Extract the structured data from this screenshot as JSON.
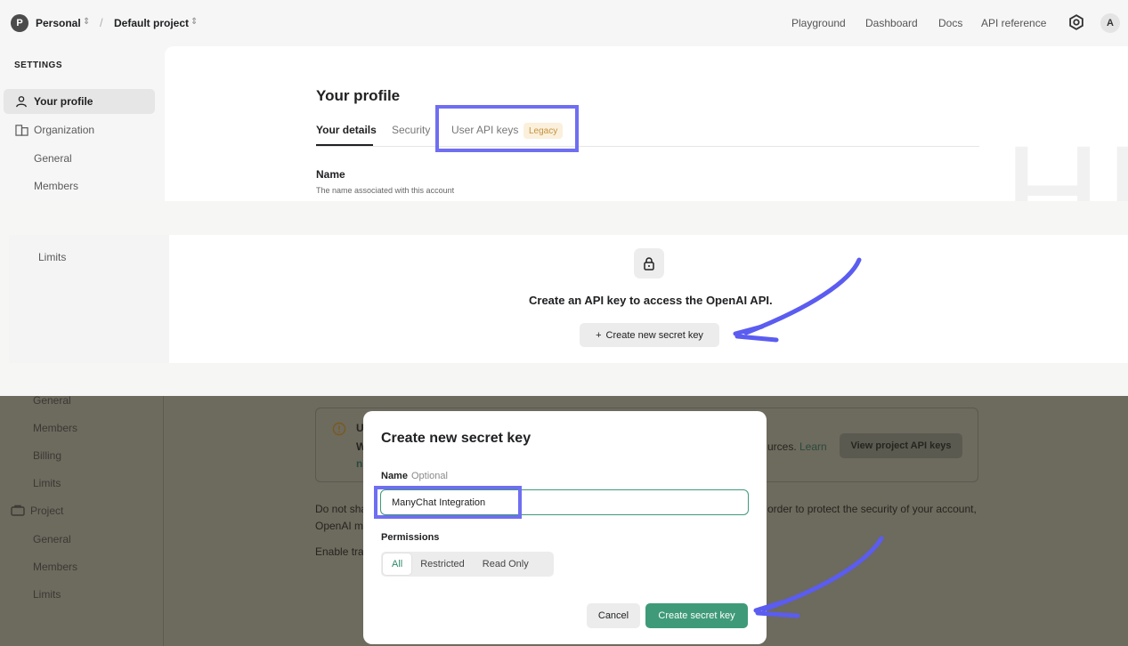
{
  "topbar": {
    "org_initial": "P",
    "org_name": "Personal",
    "project_name": "Default project",
    "separator": "/",
    "nav": [
      "Playground",
      "Dashboard",
      "Docs",
      "API reference"
    ],
    "user_initial": "A"
  },
  "sidebar": {
    "heading": "SETTINGS",
    "your_profile": "Your profile",
    "organization": "Organization",
    "org_general": "General",
    "org_members": "Members"
  },
  "profile": {
    "title": "Your profile",
    "tabs": [
      "Your details",
      "Security",
      "User API keys"
    ],
    "legacy_badge": "Legacy",
    "name_label": "Name",
    "name_sub": "The name associated with this account",
    "bg_letters": "HE"
  },
  "empty_state": {
    "limits": "Limits",
    "message": "Create an API key to access the OpenAI API.",
    "button": "Create new secret key",
    "button_plus": "+"
  },
  "panel3": {
    "sidebar": [
      "General",
      "Members",
      "Billing",
      "Limits",
      "Project",
      "General",
      "Members",
      "Limits"
    ],
    "bg_u": "U",
    "bg_w": "W",
    "bg_n": "n",
    "bg_sources": "urces.",
    "bg_learn": "Learn",
    "bg_view_btn": "View project API keys",
    "bg_do_not": "Do not sha",
    "bg_openai": "OpenAI m",
    "bg_enable": "Enable tra",
    "bg_order": "order to protect the security of your account,"
  },
  "modal": {
    "title": "Create new secret key",
    "name_label": "Name",
    "name_optional": "Optional",
    "name_value": "ManyChat Integration",
    "permissions_label": "Permissions",
    "permissions": [
      "All",
      "Restricted",
      "Read Only"
    ],
    "permissions_selected": "All",
    "cancel": "Cancel",
    "create": "Create secret key"
  },
  "colors": {
    "highlight": "#6f6ef2",
    "accent_green": "#3f9a79",
    "arrow": "#5b5cf0"
  }
}
